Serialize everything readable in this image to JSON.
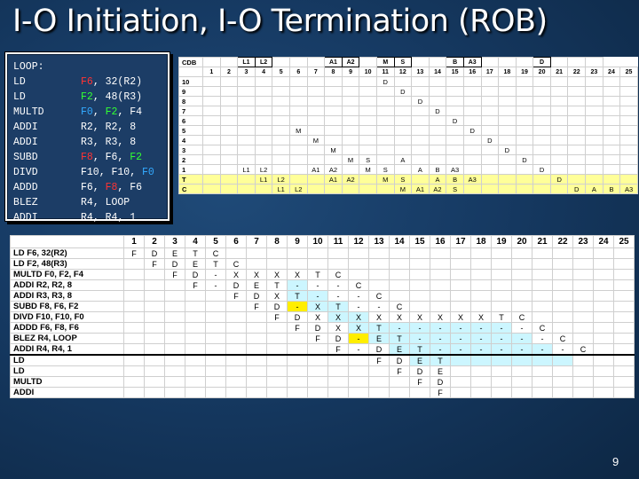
{
  "title": "I-O Initiation, I-O Termination (ROB)",
  "page_number": "9",
  "code": {
    "label": "LOOP:",
    "lines": [
      {
        "op": "LD",
        "args": [
          {
            "t": "F6",
            "c": "red"
          },
          {
            "t": ", 32(R2)",
            "c": ""
          }
        ]
      },
      {
        "op": "LD",
        "args": [
          {
            "t": "F2",
            "c": "green"
          },
          {
            "t": ", 48(R3)",
            "c": ""
          }
        ]
      },
      {
        "op": "MULTD",
        "args": [
          {
            "t": "F0",
            "c": "blue"
          },
          {
            "t": ", ",
            "c": ""
          },
          {
            "t": "F2",
            "c": "green"
          },
          {
            "t": ", F4",
            "c": ""
          }
        ]
      },
      {
        "op": "ADDI",
        "args": [
          {
            "t": "R2, R2, 8",
            "c": ""
          }
        ]
      },
      {
        "op": "ADDI",
        "args": [
          {
            "t": "R3, R3, 8",
            "c": ""
          }
        ]
      },
      {
        "op": "SUBD",
        "args": [
          {
            "t": "F8",
            "c": "red"
          },
          {
            "t": ", F6, ",
            "c": ""
          },
          {
            "t": "F2",
            "c": "green"
          }
        ]
      },
      {
        "op": "DIVD",
        "args": [
          {
            "t": "F10, F10, ",
            "c": ""
          },
          {
            "t": "F0",
            "c": "blue"
          }
        ]
      },
      {
        "op": "ADDD",
        "args": [
          {
            "t": "F6, ",
            "c": ""
          },
          {
            "t": "F8",
            "c": "red"
          },
          {
            "t": ", F6",
            "c": ""
          }
        ]
      },
      {
        "op": "BLEZ",
        "args": [
          {
            "t": "R4, LOOP",
            "c": ""
          }
        ]
      },
      {
        "op": "ADDI",
        "args": [
          {
            "t": "R4, R4, 1",
            "c": ""
          }
        ]
      }
    ]
  },
  "cdb_table": {
    "corner": "CDB",
    "header": [
      "",
      "",
      "L1",
      "L2",
      "",
      "",
      "",
      "A1",
      "A2",
      "",
      "M",
      "S",
      "",
      "",
      "B",
      "A3",
      "",
      "",
      "",
      "D",
      "",
      "",
      ""
    ],
    "boxed_header_cols": [
      2,
      3,
      7,
      8,
      10,
      11,
      14,
      15,
      19
    ],
    "cycles": [
      "1",
      "2",
      "3",
      "4",
      "5",
      "6",
      "7",
      "8",
      "9",
      "10",
      "11",
      "12",
      "13",
      "14",
      "15",
      "16",
      "17",
      "18",
      "19",
      "20",
      "21",
      "22",
      "23",
      "24",
      "25"
    ],
    "rows": [
      {
        "label": "10",
        "cells": {
          "11": "D"
        }
      },
      {
        "label": "9",
        "cells": {
          "12": "D"
        }
      },
      {
        "label": "8",
        "cells": {
          "13": "D"
        }
      },
      {
        "label": "7",
        "cells": {
          "14": "D"
        }
      },
      {
        "label": "6",
        "cells": {
          "15": "D"
        }
      },
      {
        "label": "5",
        "cells": {
          "6": "M",
          "16": "D"
        }
      },
      {
        "label": "4",
        "cells": {
          "7": "M",
          "17": "D"
        }
      },
      {
        "label": "3",
        "cells": {
          "8": "M",
          "18": "D"
        }
      },
      {
        "label": "2",
        "cells": {
          "9": "M",
          "10": "S",
          "12": "A",
          "19": "D"
        }
      },
      {
        "label": "1",
        "cells": {
          "3": "L1",
          "4": "L2",
          "7": "A1",
          "8": "A2",
          "10": "M",
          "11": "S",
          "13": "A",
          "14": "B",
          "15": "A3",
          "20": "D"
        }
      },
      {
        "label": "T",
        "cells": {
          "4": "L1",
          "5": "L2",
          "8": "A1",
          "9": "A2",
          "11": "M",
          "12": "S",
          "14": "A",
          "15": "B",
          "16": "A3",
          "21": "D"
        }
      },
      {
        "label": "C",
        "cells": {
          "5": "L1",
          "6": "L2",
          "12": "M",
          "13": "A1",
          "14": "A2",
          "15": "S",
          "22": "D",
          "23": "A",
          "24": "B",
          "25": "A3"
        }
      }
    ]
  },
  "pipeline_table": {
    "cycles": [
      "1",
      "2",
      "3",
      "4",
      "5",
      "6",
      "7",
      "8",
      "9",
      "10",
      "11",
      "12",
      "13",
      "14",
      "15",
      "16",
      "17",
      "18",
      "19",
      "20",
      "21",
      "22",
      "23",
      "24",
      "25"
    ],
    "rows": [
      {
        "instr": "LD F6, 32(R2)",
        "cells": {
          "1": "F",
          "2": "D",
          "3": "E",
          "4": "T",
          "5": "C"
        }
      },
      {
        "instr": "LD F2, 48(R3)",
        "cells": {
          "2": "F",
          "3": "D",
          "4": "E",
          "5": "T",
          "6": "C"
        }
      },
      {
        "instr": "MULTD F0, F2, F4",
        "cells": {
          "3": "F",
          "4": "D",
          "5": "-",
          "6": "X",
          "7": "X",
          "8": "X",
          "9": "X",
          "10": "T",
          "11": "C"
        }
      },
      {
        "instr": "ADDI R2, R2, 8",
        "cells": {
          "4": "F",
          "5": "-",
          "6": "D",
          "7": "E",
          "8": "T",
          "9": "-",
          "10": "-",
          "11": "-",
          "12": "C"
        }
      },
      {
        "instr": "ADDI R3, R3, 8",
        "cells": {
          "6": "F",
          "7": "D",
          "8": "X",
          "9": "T",
          "10": "-",
          "11": "-",
          "12": "-",
          "13": "C"
        }
      },
      {
        "instr": "SUBD F8, F6, F2",
        "cells": {
          "7": "F",
          "8": "D",
          "9": "-",
          "10": "X",
          "11": "T",
          "12": "-",
          "13": "-",
          "14": "C"
        }
      },
      {
        "instr": "DIVD F10, F10, F0",
        "cells": {
          "8": "F",
          "9": "D",
          "10": "X",
          "11": "X",
          "12": "X",
          "13": "X",
          "14": "X",
          "15": "X",
          "16": "X",
          "17": "X",
          "18": "X",
          "19": "T",
          "20": "C"
        }
      },
      {
        "instr": "ADDD F6, F8, F6",
        "cells": {
          "9": "F",
          "10": "D",
          "11": "X",
          "12": "X",
          "13": "T",
          "14": "-",
          "15": "-",
          "16": "-",
          "17": "-",
          "18": "-",
          "19": "-",
          "20": "-",
          "21": "C"
        }
      },
      {
        "instr": "BLEZ R4, LOOP",
        "cells": {
          "10": "F",
          "11": "D",
          "12": "-",
          "13": "E",
          "14": "T",
          "15": "-",
          "16": "-",
          "17": "-",
          "18": "-",
          "19": "-",
          "20": "-",
          "21": "-",
          "22": "C"
        }
      },
      {
        "instr": "ADDI R4, R4, 1",
        "cells": {
          "11": "F",
          "12": "-",
          "13": "D",
          "14": "E",
          "15": "T",
          "16": "-",
          "17": "-",
          "18": "-",
          "19": "-",
          "20": "-",
          "21": "-",
          "22": "-",
          "23": "C"
        }
      },
      {
        "instr": "LD",
        "cells": {
          "13": "F",
          "14": "D",
          "15": "E",
          "16": "T"
        }
      },
      {
        "instr": "LD",
        "cells": {
          "14": "F",
          "15": "D",
          "16": "E"
        }
      },
      {
        "instr": "MULTD",
        "cells": {
          "15": "F",
          "16": "D"
        }
      },
      {
        "instr": "ADDI",
        "cells": {
          "16": "F"
        }
      }
    ],
    "highlights": {
      "cyan": [
        [
          3,
          9
        ],
        [
          4,
          9
        ],
        [
          4,
          10
        ],
        [
          5,
          10
        ],
        [
          5,
          11
        ],
        [
          6,
          11
        ],
        [
          6,
          12
        ],
        [
          7,
          12
        ],
        [
          7,
          13
        ],
        [
          7,
          14
        ],
        [
          7,
          15
        ],
        [
          7,
          16
        ],
        [
          7,
          17
        ],
        [
          7,
          18
        ],
        [
          7,
          19
        ],
        [
          8,
          13
        ],
        [
          8,
          14
        ],
        [
          8,
          15
        ],
        [
          8,
          16
        ],
        [
          8,
          17
        ],
        [
          8,
          18
        ],
        [
          8,
          19
        ],
        [
          8,
          20
        ],
        [
          9,
          14
        ],
        [
          9,
          15
        ],
        [
          9,
          16
        ],
        [
          9,
          17
        ],
        [
          9,
          18
        ],
        [
          9,
          19
        ],
        [
          9,
          20
        ],
        [
          9,
          21
        ],
        [
          10,
          15
        ],
        [
          10,
          16
        ],
        [
          10,
          17
        ],
        [
          10,
          18
        ],
        [
          10,
          19
        ],
        [
          10,
          20
        ],
        [
          10,
          21
        ],
        [
          10,
          22
        ]
      ],
      "yellow": [
        [
          5,
          9
        ],
        [
          8,
          12
        ]
      ]
    },
    "separator_before_row": 10
  }
}
